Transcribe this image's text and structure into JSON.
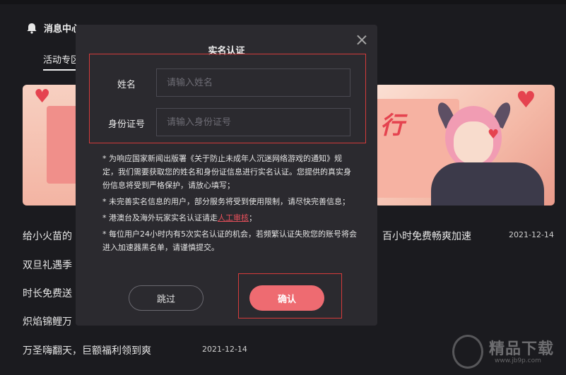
{
  "background": {
    "header_title": "消息中心",
    "tab_label": "活动专区",
    "news": [
      {
        "title": "给小火苗的",
        "suffix": "百小时免费畅爽加速",
        "date": "2021-12-14"
      },
      {
        "title": "双旦礼遇季"
      },
      {
        "title": "时长免费送"
      },
      {
        "title": "炽焰锦鲤万"
      },
      {
        "title": "万圣嗨翻天，巨额福利领到爽",
        "date": "2021-12-14"
      }
    ],
    "banner_text": "行"
  },
  "modal": {
    "title": "实名认证",
    "name_label": "姓名",
    "name_placeholder": "请输入姓名",
    "id_label": "身份证号",
    "id_placeholder": "请输入身份证号",
    "notes": [
      "* 为响应国家新闻出版署《关于防止未成年人沉迷网络游戏的通知》规定，我们需要获取您的姓名和身份证信息进行实名认证。您提供的真实身份信息将受到严格保护，请放心填写；",
      "* 未完善实名信息的用户，部分服务将受到使用限制，请尽快完善信息；",
      "* 每位用户24小时内有5次实名认证的机会，若频繁认证失败您的账号将会进入加速器黑名单，请谨慎提交。"
    ],
    "hk_note_prefix": "* 港澳台及海外玩家实名认证请走",
    "hk_note_link": "人工审核",
    "hk_note_suffix": "；",
    "skip_label": "跳过",
    "confirm_label": "确认"
  },
  "watermark": {
    "text": "精品下载",
    "url": "www.jb9p.com"
  },
  "colors": {
    "accent": "#ee6b71",
    "highlight_border": "#d63b3b",
    "modal_bg": "#2b2a2f",
    "page_bg": "#1b1b1f"
  }
}
